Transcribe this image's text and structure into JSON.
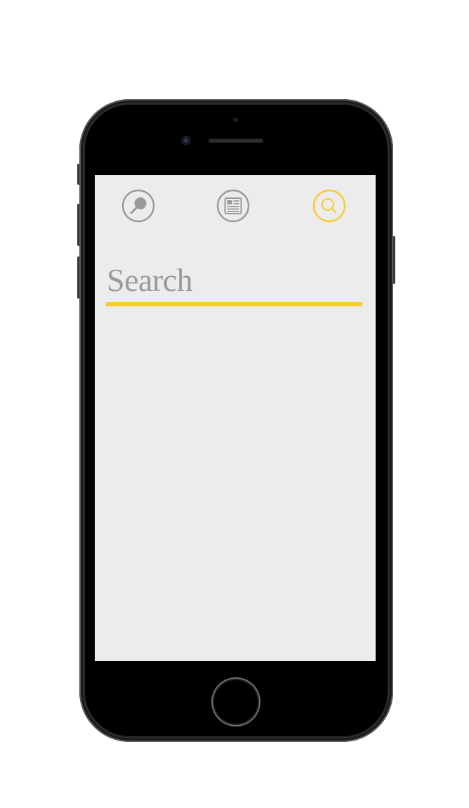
{
  "nav": {
    "items": [
      {
        "name": "discover",
        "icon": "magnifier-tilted-icon",
        "active": false
      },
      {
        "name": "articles",
        "icon": "news-article-icon",
        "active": false
      },
      {
        "name": "search",
        "icon": "search-icon",
        "active": true
      }
    ]
  },
  "search": {
    "placeholder": "Search",
    "value": ""
  },
  "colors": {
    "accent": "#f7cd2e",
    "icon_inactive": "#9a9a9a",
    "screen_background": "#ececec",
    "device_frame": "#2a2a2c"
  }
}
